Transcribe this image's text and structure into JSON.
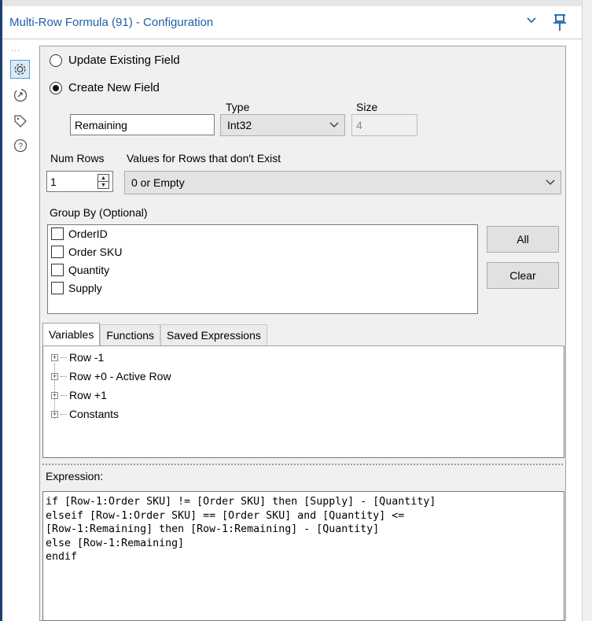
{
  "header": {
    "title": "Multi-Row Formula (91) - Configuration",
    "chevron_icon": "chevron-down-icon",
    "pin_icon": "pin-icon"
  },
  "rail": {
    "dots": "...",
    "icons": [
      "gear-icon",
      "tool-target-icon",
      "tag-icon",
      "help-icon"
    ]
  },
  "field_mode": {
    "update_label": "Update Existing Field",
    "create_label": "Create New  Field",
    "selected": "create"
  },
  "new_field": {
    "name_value": "Remaining",
    "type_label": "Type",
    "type_value": "Int32",
    "size_label": "Size",
    "size_value": "4"
  },
  "num_rows": {
    "label": "Num Rows",
    "value": "1"
  },
  "nonexist": {
    "label": "Values for Rows that don't Exist",
    "value": "0 or Empty"
  },
  "group_by": {
    "label": "Group By (Optional)",
    "items": [
      "OrderID",
      "Order SKU",
      "Quantity",
      "Supply"
    ],
    "all_button": "All",
    "clear_button": "Clear"
  },
  "tabs": [
    "Variables",
    "Functions",
    "Saved Expressions"
  ],
  "variables": [
    "Row -1",
    "Row +0 - Active Row",
    "Row +1",
    "Constants"
  ],
  "expression": {
    "label": "Expression:",
    "lines": [
      "if [Row-1:Order SKU] != [Order SKU] then [Supply] - [Quantity]",
      "elseif [Row-1:Order SKU] == [Order SKU] and [Quantity] <=",
      "[Row-1:Remaining] then [Row-1:Remaining] - [Quantity]",
      "else [Row-1:Remaining]",
      "endif"
    ]
  }
}
